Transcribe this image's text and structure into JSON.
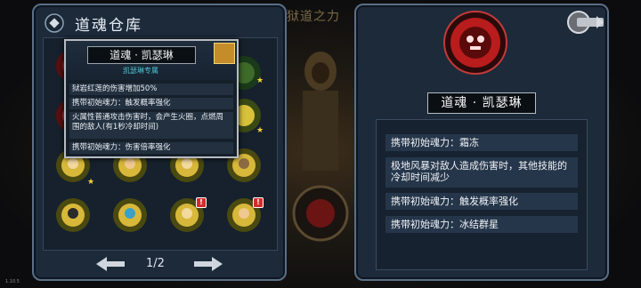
{
  "header": {
    "left_title": "道魂仓库",
    "mid_title": "狱道之力"
  },
  "pager": {
    "page": "1/2"
  },
  "tooltip": {
    "name": "道魂 · 凯瑟琳",
    "subtitle": "凯瑟琳专属",
    "rows": [
      "狱岩红莲的伤害增加50%",
      "携带初始魂力：触发概率强化",
      "火属性普通攻击伤害时，会产生火圈，点燃周围的敌人(有1秒冷却时间)",
      "携带初始魂力：伤害倍率强化"
    ]
  },
  "detail": {
    "name": "道魂 · 凯瑟琳",
    "rows": [
      "携带初始魂力：霜冻",
      "极地风暴对敌人造成伤害时，其他技能的冷却时间减少",
      "携带初始魂力：触发概率强化",
      "携带初始魂力：冰结群星"
    ]
  },
  "colors": {
    "accent_gold": "#f4d23a",
    "badge_red": "#d42c2c",
    "panel_bg": "#1c2a3a"
  },
  "version": "1.10.5"
}
